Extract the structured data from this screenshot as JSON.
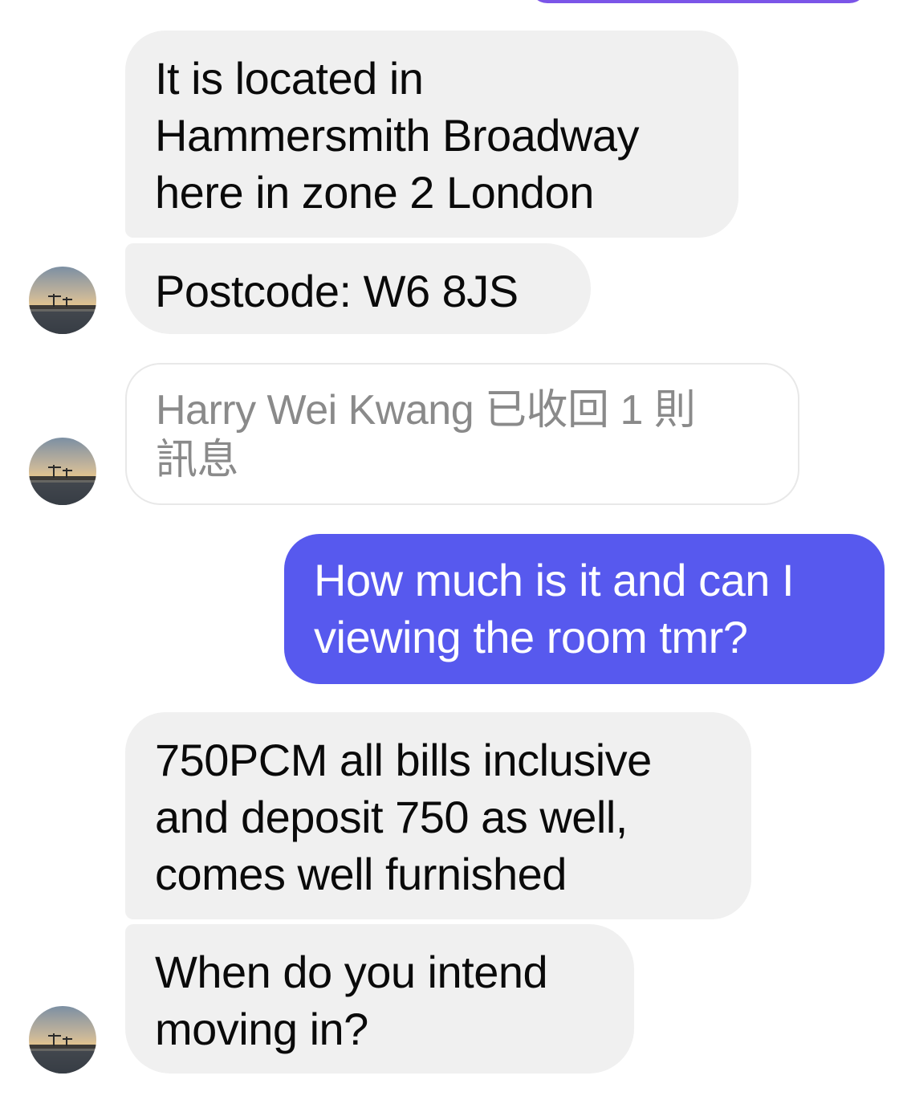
{
  "conversation": {
    "messages": [
      {
        "sender": "other",
        "lines": [
          "It is located in",
          "Hammersmith Broadway",
          "here in zone 2 London"
        ]
      },
      {
        "sender": "other",
        "lines": [
          "Postcode: W6 8JS"
        ]
      },
      {
        "sender": "other",
        "type": "unsent_notice",
        "lines": [
          "Harry Wei Kwang 已收回 1 則",
          "訊息"
        ]
      },
      {
        "sender": "me",
        "lines": [
          "How much is it and can I",
          "viewing the room tmr?"
        ]
      },
      {
        "sender": "other",
        "lines": [
          "750PCM all bills inclusive",
          "and deposit 750 as well,",
          "comes well furnished"
        ]
      },
      {
        "sender": "other",
        "lines": [
          "When do you intend",
          "moving in?"
        ]
      }
    ]
  },
  "contact": {
    "avatar_icon": "harbor-sunset-avatar"
  },
  "colors": {
    "sent_bubble": "#5759ee",
    "received_bubble": "#f0f0f0",
    "unsent_text": "#8a8a8a",
    "top_partial_bubble": "#7b55e8"
  }
}
